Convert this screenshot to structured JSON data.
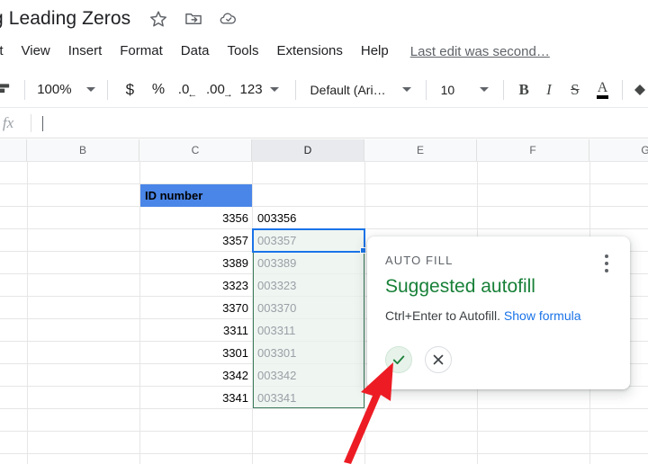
{
  "titlebar": {
    "doc_title": "g Leading Zeros",
    "icons": [
      {
        "name": "star-icon",
        "label": "star"
      },
      {
        "name": "move-to-folder-icon",
        "label": "move to folder"
      },
      {
        "name": "cloud-saved-icon",
        "label": "saved to Drive"
      }
    ]
  },
  "menubar": {
    "items": [
      "it",
      "View",
      "Insert",
      "Format",
      "Data",
      "Tools",
      "Extensions",
      "Help"
    ],
    "last_edit": "Last edit was second…"
  },
  "toolbar": {
    "paint_format_icon": "paint-format-icon",
    "zoom": "100%",
    "currency": "$",
    "percent": "%",
    "decrease_decimal": ".0",
    "increase_decimal": ".00",
    "number_format": "123",
    "font_family": "Default (Ari…",
    "font_size": "10",
    "bold": "B",
    "italic": "I",
    "strikethrough": "S",
    "text_color": "A"
  },
  "formula_bar": {
    "fx": "fx",
    "value": ""
  },
  "grid": {
    "columns": [
      {
        "label": "B",
        "selected": false
      },
      {
        "label": "C",
        "selected": false
      },
      {
        "label": "D",
        "selected": true
      },
      {
        "label": "E",
        "selected": false
      },
      {
        "label": "F",
        "selected": false
      },
      {
        "label": "G",
        "selected": false
      }
    ],
    "col_c_header": "ID number",
    "rows": [
      {
        "c": "3356",
        "d": "003356",
        "ghost": false
      },
      {
        "c": "3357",
        "d": "003357",
        "ghost": true
      },
      {
        "c": "3389",
        "d": "003389",
        "ghost": true
      },
      {
        "c": "3323",
        "d": "003323",
        "ghost": true
      },
      {
        "c": "3370",
        "d": "003370",
        "ghost": true
      },
      {
        "c": "3311",
        "d": "003311",
        "ghost": true
      },
      {
        "c": "3301",
        "d": "003301",
        "ghost": true
      },
      {
        "c": "3342",
        "d": "003342",
        "ghost": true
      },
      {
        "c": "3341",
        "d": "003341",
        "ghost": true
      }
    ],
    "selected_cell": "D3",
    "header_fill_color": "#4a86e8",
    "suggestion_fill_color": "#e9f2ec"
  },
  "autofill": {
    "label": "AUTO FILL",
    "title": "Suggested autofill",
    "hint": "Ctrl+Enter to Autofill.",
    "link": "Show formula",
    "accept_icon": "check-icon",
    "reject_icon": "close-icon",
    "menu_icon": "more-options-icon",
    "accent_color": "#188038",
    "link_color": "#1a73e8"
  },
  "annotation": {
    "arrow_color": "#ed1c24",
    "points_to": "accept-autofill-button"
  }
}
